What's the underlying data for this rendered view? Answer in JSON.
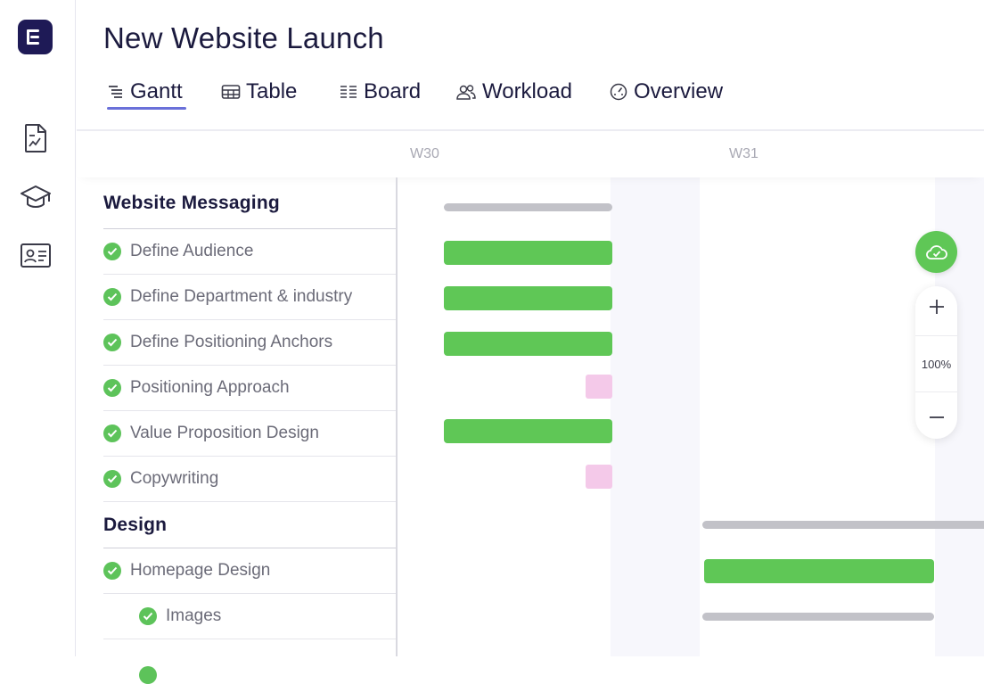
{
  "project": {
    "title": "New Website Launch"
  },
  "tabs": [
    {
      "label": "Gantt",
      "icon": "gantt-icon",
      "active": true
    },
    {
      "label": "Table",
      "icon": "table-icon"
    },
    {
      "label": "Board",
      "icon": "board-icon"
    },
    {
      "label": "Workload",
      "icon": "users-icon"
    },
    {
      "label": "Overview",
      "icon": "gauge-icon"
    }
  ],
  "sidebar": {
    "icons": [
      "logo-icon",
      "report-icon",
      "graduation-cap-icon",
      "contact-card-icon"
    ]
  },
  "timeline": {
    "weeks": [
      "W30",
      "W31"
    ]
  },
  "groups": [
    {
      "name": "Website Messaging",
      "tasks": [
        {
          "name": "Define Audience",
          "done": true,
          "bar": "green"
        },
        {
          "name": "Define Department & industry",
          "done": true,
          "bar": "green"
        },
        {
          "name": "Define Positioning Anchors",
          "done": true,
          "bar": "green"
        },
        {
          "name": "Positioning Approach",
          "done": true,
          "bar": "milestone"
        },
        {
          "name": "Value Proposition Design",
          "done": true,
          "bar": "green"
        },
        {
          "name": "Copywriting",
          "done": true,
          "bar": "milestone"
        }
      ]
    },
    {
      "name": "Design",
      "tasks": [
        {
          "name": "Homepage Design",
          "done": true,
          "bar": "green"
        },
        {
          "name": "Images",
          "done": true,
          "subtask": true,
          "bar": "summary"
        }
      ]
    }
  ],
  "zoom": {
    "level": "100%",
    "zoom_in_icon": "plus-icon",
    "zoom_out_icon": "minus-icon",
    "save_icon": "cloud-check-icon"
  },
  "colors": {
    "brand": "#1e1a56",
    "accent": "#6a70d9",
    "done": "#5fc756",
    "milestone": "#f4c9e9",
    "summary": "#c2c2c8"
  }
}
